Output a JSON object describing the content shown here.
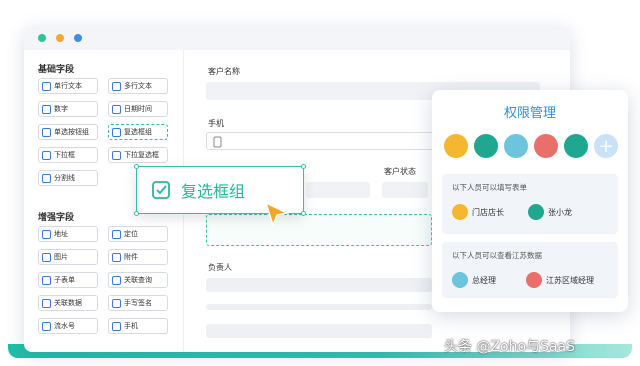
{
  "left_panel": {
    "basic_title": "基础字段",
    "basic_fields": [
      {
        "label": "单行文本",
        "icon": "single-line-text-icon"
      },
      {
        "label": "多行文本",
        "icon": "multi-line-text-icon"
      },
      {
        "label": "数字",
        "icon": "number-icon"
      },
      {
        "label": "日期时间",
        "icon": "datetime-icon"
      },
      {
        "label": "单选按钮组",
        "icon": "radio-icon"
      },
      {
        "label": "复选框组",
        "icon": "checkbox-icon"
      },
      {
        "label": "下拉框",
        "icon": "dropdown-icon"
      },
      {
        "label": "下拉复选框",
        "icon": "dropdown-checkbox-icon"
      },
      {
        "label": "分割线",
        "icon": "divider-icon"
      }
    ],
    "advanced_title": "增强字段",
    "advanced_fields": [
      {
        "label": "地址",
        "icon": "location-icon"
      },
      {
        "label": "定位",
        "icon": "position-icon"
      },
      {
        "label": "图片",
        "icon": "image-icon"
      },
      {
        "label": "附件",
        "icon": "attachment-icon"
      },
      {
        "label": "子表单",
        "icon": "subform-icon"
      },
      {
        "label": "关联查询",
        "icon": "lookup-icon"
      },
      {
        "label": "关联数据",
        "icon": "related-data-icon"
      },
      {
        "label": "手写签名",
        "icon": "signature-icon"
      },
      {
        "label": "流水号",
        "icon": "serial-number-icon"
      },
      {
        "label": "手机",
        "icon": "phone-icon"
      }
    ]
  },
  "form": {
    "customer_name_label": "客户名称",
    "phone_label": "手机",
    "customer_status_label": "客户状态",
    "owner_label": "负责人"
  },
  "drag_card": {
    "label": "复选框组"
  },
  "permissions": {
    "title": "权限管理",
    "fill_title": "以下人员可以填写表单",
    "fill_users": [
      "门店店长",
      "张小龙"
    ],
    "view_title": "以下人员可以查看江苏数据",
    "view_users": [
      "总经理",
      "江苏区域经理"
    ]
  },
  "watermark": "头条 @Zoho与SaaS",
  "colors": {
    "accent": "#2fbfa6",
    "title_blue": "#2f8fd6"
  }
}
